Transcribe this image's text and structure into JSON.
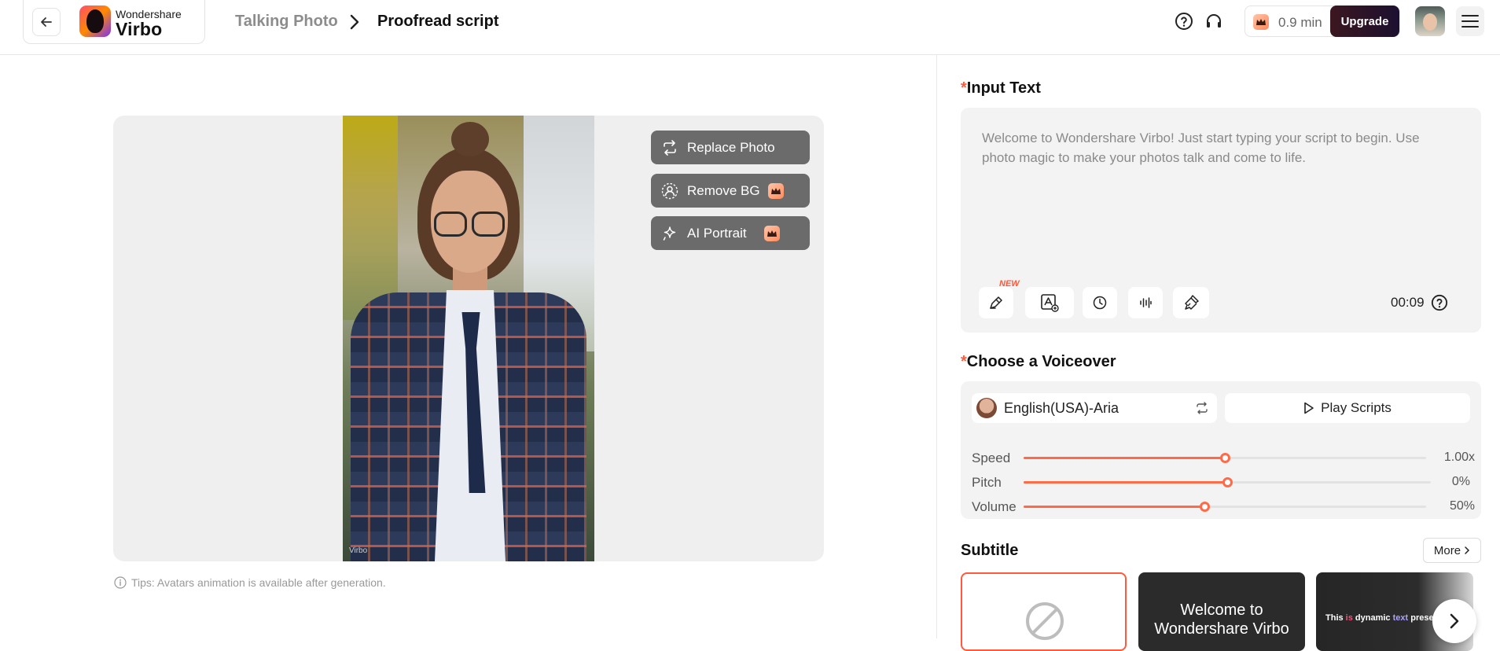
{
  "header": {
    "brand_top": "Wondershare",
    "brand_name": "Virbo",
    "breadcrumb_parent": "Talking Photo",
    "breadcrumb_current": "Proofread script",
    "credits": "0.9 min",
    "upgrade_label": "Upgrade",
    "icons": [
      "back-arrow-icon",
      "help-icon",
      "headset-icon",
      "crown-icon",
      "menu-icon"
    ]
  },
  "preview": {
    "tools": [
      {
        "label": "Replace Photo",
        "icon": "replace-icon",
        "premium": false
      },
      {
        "label": "Remove BG",
        "icon": "person-cutout-icon",
        "premium": true
      },
      {
        "label": "AI Portrait",
        "icon": "sparkle-icon",
        "premium": true
      }
    ],
    "watermark": "Virbo",
    "tips": "Tips: Avatars animation is available after generation."
  },
  "input_text": {
    "title": "Input Text",
    "required_mark": "*",
    "content": "Welcome to Wondershare Virbo! Just start typing your script to begin. Use photo magic to make your photos talk and come to life.",
    "new_badge": "NEW",
    "duration": "00:09",
    "toolbar_icons": [
      "ai-write-icon",
      "text-image-icon",
      "pause-clock-icon",
      "audio-wave-icon",
      "clean-brush-icon"
    ]
  },
  "voiceover": {
    "title": "Choose a Voiceover",
    "required_mark": "*",
    "voice_name": "English(USA)-Aria",
    "play_label": "Play Scripts",
    "sliders": [
      {
        "label": "Speed",
        "value": "1.00x",
        "level": 0.5
      },
      {
        "label": "Pitch",
        "value": "0%",
        "level": 0.5
      },
      {
        "label": "Volume",
        "value": "50%",
        "level": 0.45
      }
    ]
  },
  "subtitle": {
    "title": "Subtitle",
    "more_label": "More",
    "presets": [
      {
        "name": "none",
        "text": ""
      },
      {
        "name": "classic",
        "text": "Welcome to Wondershare Virbo"
      },
      {
        "name": "dynamic",
        "text_parts": [
          "This ",
          "is",
          " dynamic ",
          "text",
          " preset."
        ]
      }
    ]
  },
  "colors": {
    "accent": "#ff5a3c",
    "slider": "#ff6a48",
    "tool_bg": "#6b6b6b",
    "panel_bg": "#f3f3f3"
  }
}
